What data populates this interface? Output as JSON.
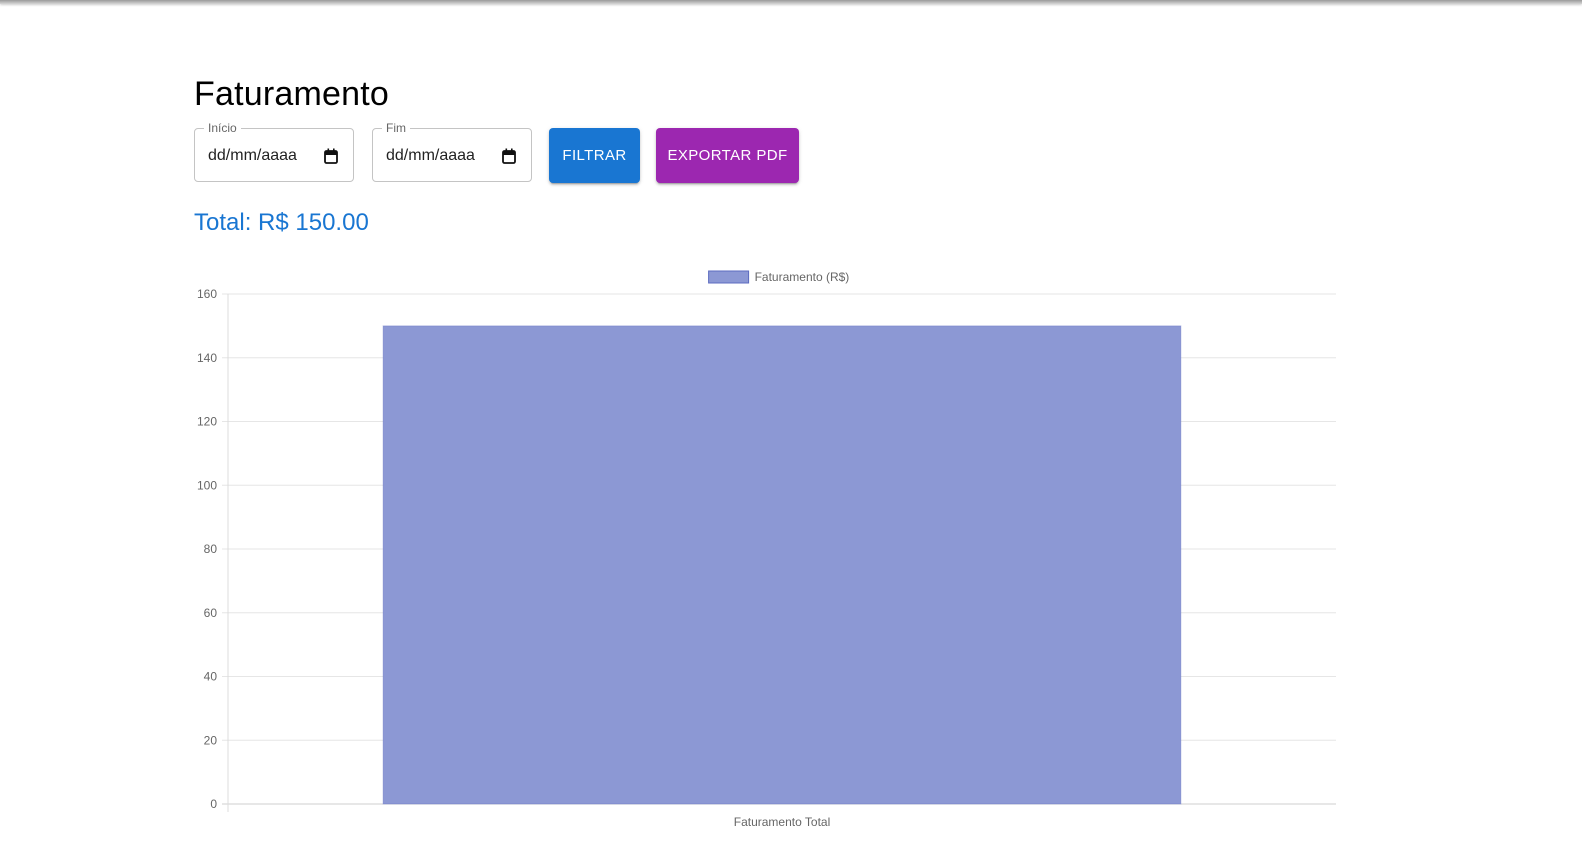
{
  "page": {
    "title": "Faturamento",
    "total_label": "Total: R$ 150.00"
  },
  "filters": {
    "start": {
      "label": "Início",
      "value": "dd/mm/aaaa",
      "icon": "calendar-icon"
    },
    "end": {
      "label": "Fim",
      "value": "dd/mm/aaaa",
      "icon": "calendar-icon"
    }
  },
  "buttons": {
    "filter_label": "FILTRAR",
    "export_label": "EXPORTAR PDF"
  },
  "colors": {
    "filter_button": "#1976d2",
    "export_button": "#9c27b0",
    "total_text": "#1976d2",
    "bar_fill": "#8c98d4",
    "bar_border": "#5c6bc0"
  },
  "chart_data": {
    "type": "bar",
    "categories": [
      "Faturamento Total"
    ],
    "series": [
      {
        "name": "Faturamento (R$)",
        "values": [
          150
        ]
      }
    ],
    "title": "",
    "xlabel": "",
    "ylabel": "",
    "ylim": [
      0,
      160
    ],
    "yticks": [
      0,
      20,
      40,
      60,
      80,
      100,
      120,
      140,
      160
    ],
    "grid": true,
    "legend": "top-center"
  }
}
